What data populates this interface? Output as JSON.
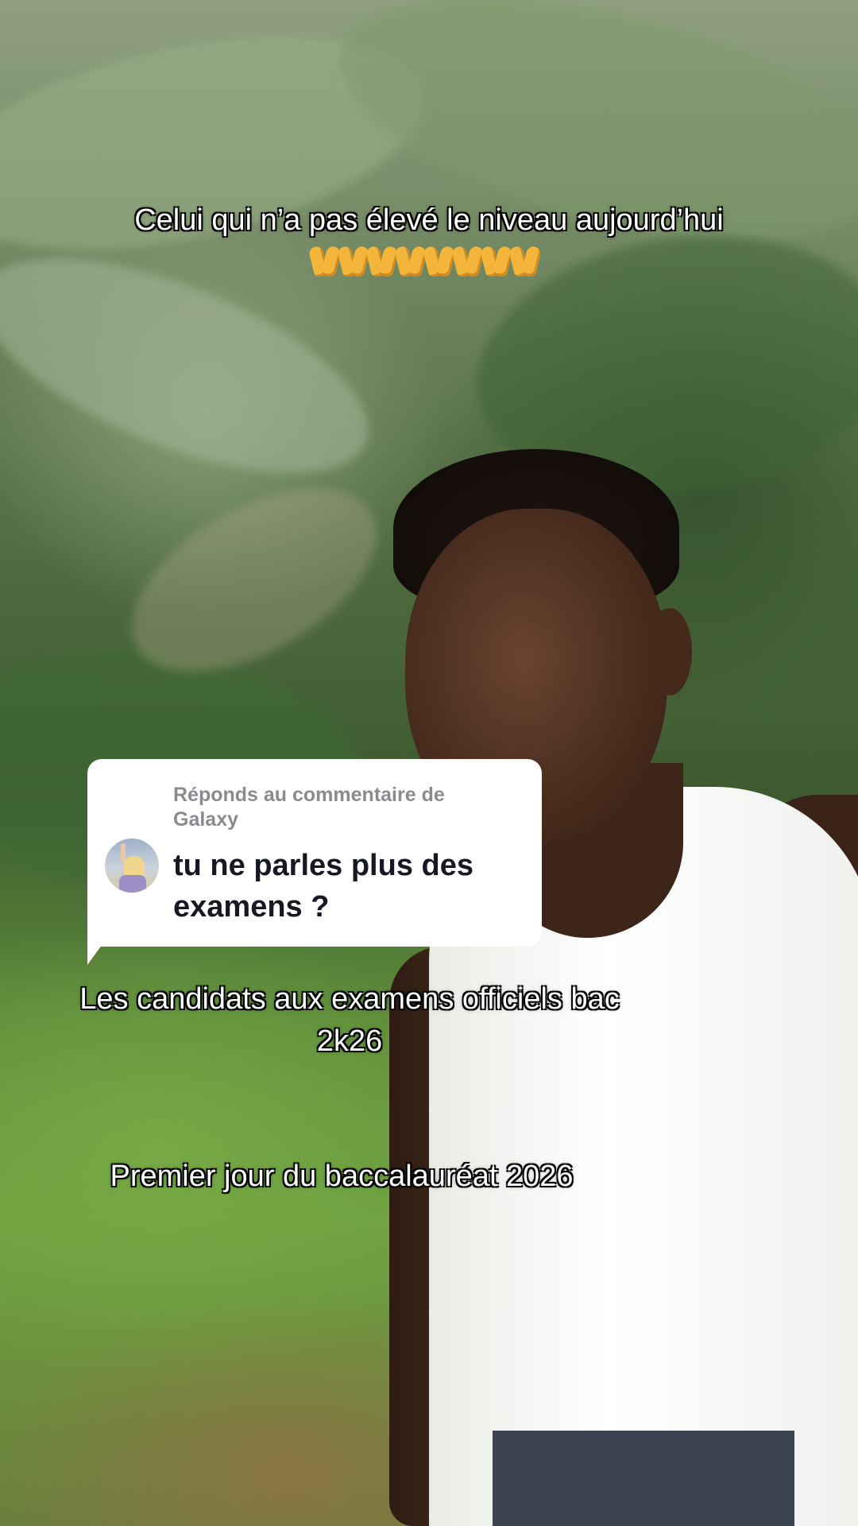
{
  "captions": {
    "top": "Celui qui n’a pas élevé le niveau aujourd’hui",
    "top_emojis": [
      "raising-hands",
      "raising-hands",
      "raising-hands",
      "raising-hands",
      "raising-hands",
      "raising-hands",
      "raising-hands",
      "raising-hands"
    ],
    "middle_line1": "Les candidats aux examens officiels bac",
    "middle_line2": "2k26",
    "bottom": "Premier jour du baccalauréat 2026"
  },
  "reply_card": {
    "header": "Réponds au commentaire de Galaxy",
    "comment": "tu ne parles plus des examens ?",
    "avatar_icon": "user-avatar"
  },
  "colors": {
    "caption_text": "#ffffff",
    "caption_outline": "#000000",
    "card_background": "#ffffff",
    "card_header_text": "#8a8b91",
    "card_comment_text": "#161823",
    "emoji": "#f4b63a"
  }
}
